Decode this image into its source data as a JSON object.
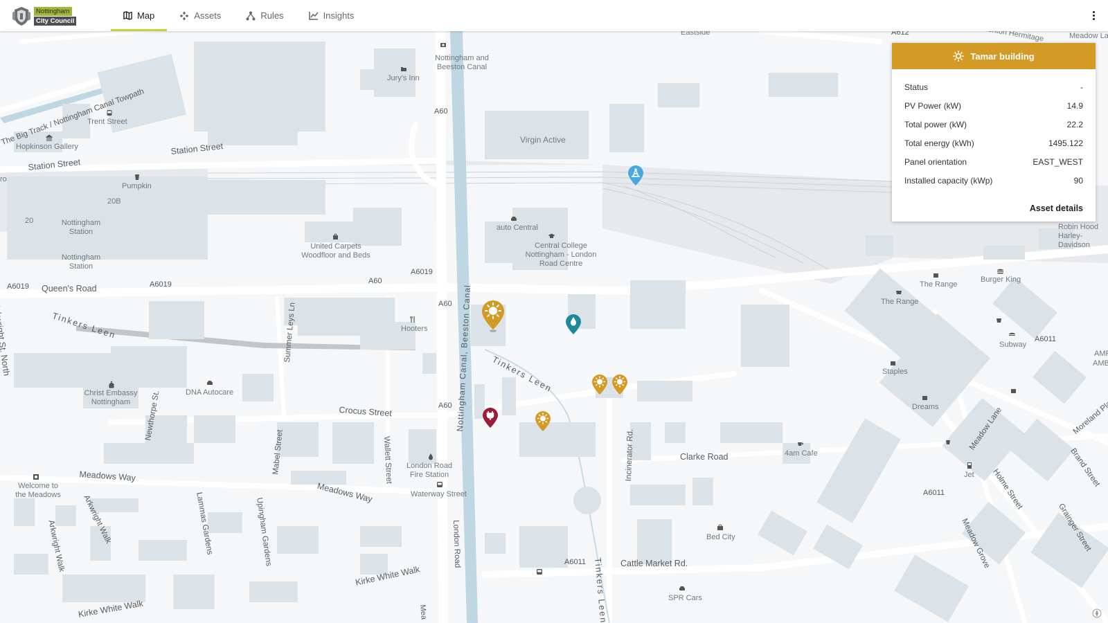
{
  "brand": {
    "line1": "Nottingham",
    "line2": "City Council",
    "accent": "#c9d13a"
  },
  "nav": {
    "items": [
      {
        "label": "Map",
        "icon": "map-icon",
        "active": true
      },
      {
        "label": "Assets",
        "icon": "assets-icon"
      },
      {
        "label": "Rules",
        "icon": "rules-icon"
      },
      {
        "label": "Insights",
        "icon": "insights-icon"
      }
    ]
  },
  "map": {
    "labels": {
      "eastside": "Eastside",
      "a612": "A612",
      "lemon_hermitage": "Lenton Hermitage",
      "meadow_lane_top": "Meadow La",
      "nottingham_beeston_canal": "Nottingham and Beeston Canal",
      "jurys_inn": "Jury's Inn",
      "a60_1": "A60",
      "a60_2": "A60",
      "a60_3": "A60",
      "a60_4": "A60",
      "virgin_active": "Virgin Active",
      "trent_street": "Trent Street",
      "hopkinson_gallery": "Hopkinson Gallery",
      "station_street_1": "Station Street",
      "station_street_2": "Station Street",
      "big_track": "The Big Track / Nottingham Canal Towpath",
      "pumpkin": "Pumpkin",
      "n_20b": "20B",
      "n_20": "20",
      "ro": "ro",
      "nottingham_station_1": "Nottingham Station",
      "nottingham_station_2": "Nottingham Station",
      "united_carpets": "United Carpets Woodfloor and Beds",
      "auto_central": "auto Central",
      "central_college": "Central College Nottingham - London Road Centre",
      "a6019_1": "A6019",
      "a6019_2": "A6019",
      "a6019_3": "A6019",
      "queens_road": "Queen's Road",
      "a60_5": "A60",
      "nottingham_canal_vertical": "Nottingham Canal, Beeston Canal",
      "tinkers_leen_1": "Tinkers Leen",
      "tinkers_leen_2": "Tinkers Leen",
      "tinkers_leen_3": "Tinkers Leen",
      "hooters": "Hooters",
      "arkwright_north": "Arkwright St. North",
      "summer_leys": "Summer Leys Ln",
      "christ_embassy": "Christ Embassy Nottingham",
      "dna_autocare": "DNA Autocare",
      "crocus_street": "Crocus Street",
      "newthorpe": "Newthorpe St.",
      "mabel_street": "Mabel Street",
      "wallett_street": "Wallett Street",
      "london_road_fire": "London Road Fire Station",
      "waterway_street": "Waterway Street",
      "meadows_way_1": "Meadows Way",
      "meadows_way_2": "Meadows Way",
      "welcome_meadows": "Welcome to the Meadows",
      "arkwright_walk_1": "Arkwright Walk",
      "arkwright_walk_2": "Arkwright Walk",
      "lammas_gardens": "Lammas Gardens",
      "upingham_gardens": "Upingham Gardens",
      "london_road": "London Road",
      "kirke_white_walk_1": "Kirke White Walk",
      "kirke_white_walk_2": "Kirke White Walk",
      "mea": "Mea",
      "a6011_1": "A6011",
      "a6011_2": "A6011",
      "a6011_3": "A6011",
      "cattle_market": "Cattle Market Rd.",
      "incinerator_rd": "Incinerator Rd.",
      "spr_cars": "SPR Cars",
      "bed_city": "Bed City",
      "clarke_road": "Clarke Road",
      "fouram_cafe": "4am Cafe",
      "the_range_1": "The Range",
      "the_range_2": "The Range",
      "burger_king": "Burger King",
      "subway": "Subway",
      "staples": "Staples",
      "dreams": "Dreams",
      "meadow_lane": "Meadow Lane",
      "jet": "Jet",
      "holme_street": "Holme Street",
      "meadow_grove": "Meadow Grove",
      "grainger_street": "Grainger Street",
      "brand_street": "Brand Street",
      "moreland_place": "Moreland Pla",
      "amf": "AMF",
      "amb": "AMB",
      "robin_hood": "Robin Hood Harley-Davidson"
    },
    "markers": [
      {
        "kind": "solar",
        "color": "#d39a26",
        "selected": true
      },
      {
        "kind": "solar",
        "color": "#d39a26"
      },
      {
        "kind": "solar",
        "color": "#d39a26"
      },
      {
        "kind": "solar",
        "color": "#d39a26"
      },
      {
        "kind": "water-drop",
        "color": "#1e8a99"
      },
      {
        "kind": "ev-plug",
        "color": "#9b1c3a"
      },
      {
        "kind": "sensor",
        "color": "#4aa8de"
      }
    ]
  },
  "panel": {
    "title": "Tamar building",
    "header_color": "#d39a26",
    "rows": [
      {
        "label": "Status",
        "value": "-"
      },
      {
        "label": "PV Power (kW)",
        "value": "14.9"
      },
      {
        "label": "Total power (kW)",
        "value": "22.2"
      },
      {
        "label": "Total energy (kWh)",
        "value": "1495.122"
      },
      {
        "label": "Panel orientation",
        "value": "EAST_WEST"
      },
      {
        "label": "Installed capacity (kWp)",
        "value": "90"
      }
    ],
    "link": "Asset details"
  }
}
